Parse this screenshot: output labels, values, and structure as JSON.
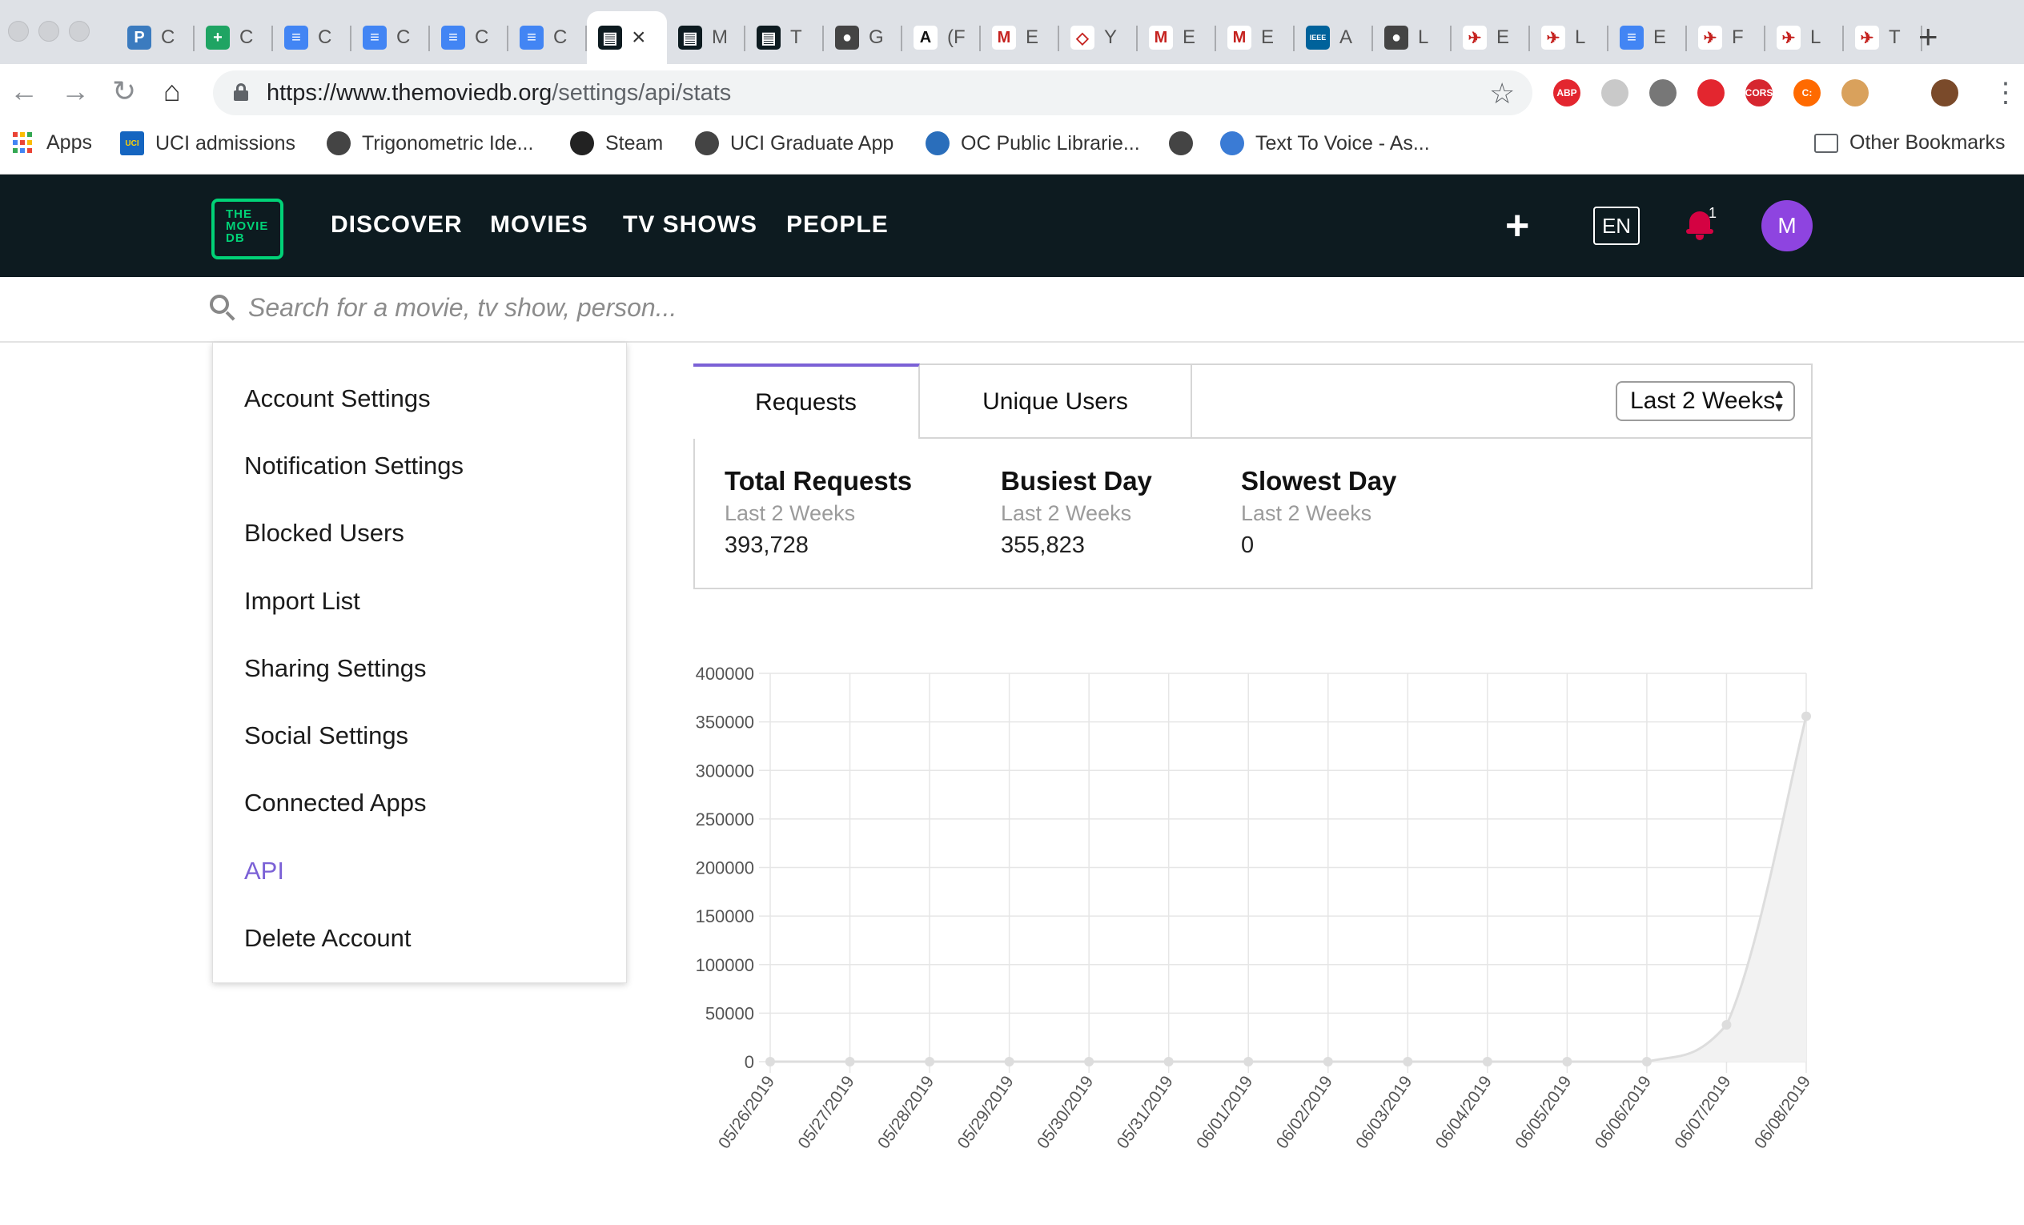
{
  "browser": {
    "tabs": [
      {
        "title": "C",
        "favicon": "P",
        "color": "#3b7bbf"
      },
      {
        "title": "C",
        "favicon": "+",
        "color": "#1fa463"
      },
      {
        "title": "C",
        "favicon": "≡",
        "color": "#4285f4"
      },
      {
        "title": "C",
        "favicon": "≡",
        "color": "#4285f4"
      },
      {
        "title": "C",
        "favicon": "≡",
        "color": "#4285f4"
      },
      {
        "title": "C",
        "favicon": "≡",
        "color": "#4285f4"
      },
      {
        "title": "",
        "favicon": "▤",
        "color": "#0d1b20",
        "active": true
      },
      {
        "title": "M",
        "favicon": "▤",
        "color": "#0d1b20"
      },
      {
        "title": "T",
        "favicon": "▤",
        "color": "#0d1b20"
      },
      {
        "title": "G",
        "favicon": "●",
        "color": "#444444"
      },
      {
        "title": "(F",
        "favicon": "A",
        "color": "#ffffff"
      },
      {
        "title": "E",
        "favicon": "M",
        "color": "#ffffff"
      },
      {
        "title": "Y",
        "favicon": "◇",
        "color": "#ffffff"
      },
      {
        "title": "E",
        "favicon": "M",
        "color": "#ffffff"
      },
      {
        "title": "E",
        "favicon": "M",
        "color": "#ffffff"
      },
      {
        "title": "A",
        "favicon": "IEEE",
        "color": "#00629b"
      },
      {
        "title": "L",
        "favicon": "●",
        "color": "#444444"
      },
      {
        "title": "E",
        "favicon": "✈",
        "color": "#ffffff"
      },
      {
        "title": "L",
        "favicon": "✈",
        "color": "#ffffff"
      },
      {
        "title": "E",
        "favicon": "≡",
        "color": "#4285f4"
      },
      {
        "title": "F",
        "favicon": "✈",
        "color": "#ffffff"
      },
      {
        "title": "L",
        "favicon": "✈",
        "color": "#ffffff"
      },
      {
        "title": "T",
        "favicon": "✈",
        "color": "#ffffff"
      }
    ],
    "url_host": "https://www.themoviedb.org",
    "url_path": "/settings/api/stats",
    "bookmarks": [
      {
        "label": "Apps",
        "icon": "apps-grid-icon"
      },
      {
        "label": "UCI admissions",
        "icon": "uci-icon"
      },
      {
        "label": "Trigonometric Ide...",
        "icon": "globe-icon"
      },
      {
        "label": "Steam",
        "icon": "steam-icon"
      },
      {
        "label": "UCI Graduate App",
        "icon": "globe-icon"
      },
      {
        "label": "OC Public Librarie...",
        "icon": "library-icon"
      },
      {
        "label": "",
        "icon": "globe-icon"
      },
      {
        "label": "Text To Voice - As...",
        "icon": "voice-icon"
      }
    ],
    "other_bookmarks": "Other Bookmarks",
    "extensions": [
      "ABP",
      "",
      "",
      "",
      "CORS",
      "C:",
      "",
      ""
    ]
  },
  "site": {
    "logo_lines": [
      "THE",
      "MOVIE",
      "DB"
    ],
    "nav": [
      "DISCOVER",
      "MOVIES",
      "TV SHOWS",
      "PEOPLE"
    ],
    "lang": "EN",
    "notification_count": "1",
    "avatar_initial": "M",
    "search_placeholder": "Search for a movie, tv show, person..."
  },
  "sidebar": {
    "items": [
      {
        "label": "Account Settings"
      },
      {
        "label": "Notification Settings"
      },
      {
        "label": "Blocked Users"
      },
      {
        "label": "Import List"
      },
      {
        "label": "Sharing Settings"
      },
      {
        "label": "Social Settings"
      },
      {
        "label": "Connected Apps"
      },
      {
        "label": "API",
        "active": true
      },
      {
        "label": "Delete Account"
      }
    ]
  },
  "stats": {
    "tabs": [
      "Requests",
      "Unique Users"
    ],
    "range": "Last 2 Weeks",
    "cards": [
      {
        "title": "Total Requests",
        "sub": "Last 2 Weeks",
        "value": "393,728"
      },
      {
        "title": "Busiest Day",
        "sub": "Last 2 Weeks",
        "value": "355,823"
      },
      {
        "title": "Slowest Day",
        "sub": "Last 2 Weeks",
        "value": "0"
      }
    ]
  },
  "colors": {
    "accent": "#7b61d6",
    "brand_green": "#01d277",
    "nav_bg": "#0d1b20",
    "notification": "#d40242"
  },
  "chart_data": {
    "type": "area",
    "title": "",
    "xlabel": "",
    "ylabel": "",
    "ylim": [
      0,
      400000
    ],
    "yticks": [
      0,
      50000,
      100000,
      150000,
      200000,
      250000,
      300000,
      350000,
      400000
    ],
    "x": [
      "05/26/2019",
      "05/27/2019",
      "05/28/2019",
      "05/29/2019",
      "05/30/2019",
      "05/31/2019",
      "06/01/2019",
      "06/02/2019",
      "06/03/2019",
      "06/04/2019",
      "06/05/2019",
      "06/06/2019",
      "06/07/2019",
      "06/08/2019"
    ],
    "series": [
      {
        "values": [
          0,
          0,
          0,
          0,
          0,
          0,
          0,
          0,
          0,
          0,
          0,
          0,
          37905,
          355823
        ]
      }
    ],
    "grid": true,
    "legend": "none"
  }
}
